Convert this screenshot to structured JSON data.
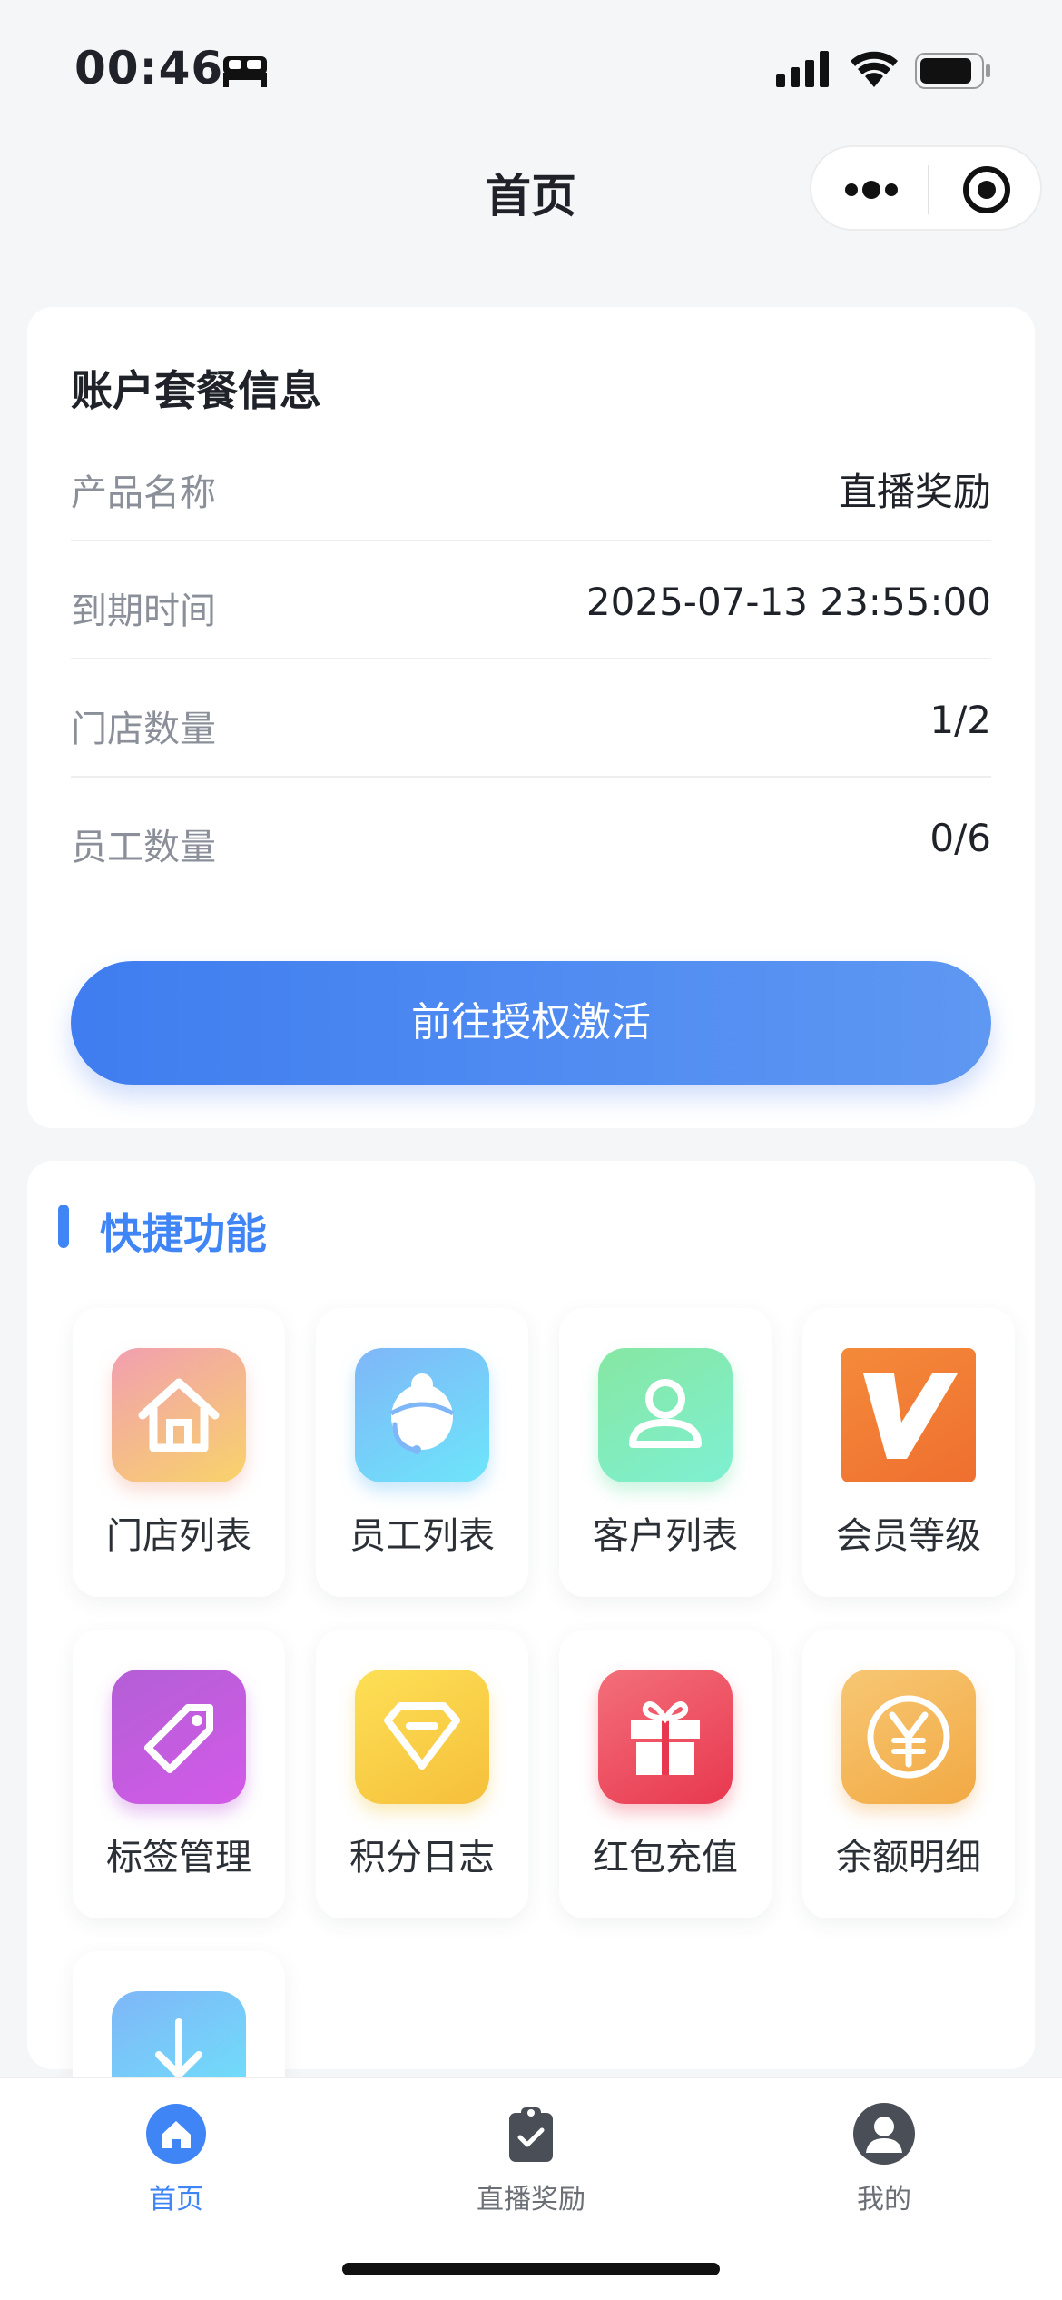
{
  "status_bar": {
    "time": "00:46"
  },
  "nav": {
    "title": "首页"
  },
  "account_card": {
    "title": "账户套餐信息",
    "rows": [
      {
        "label": "产品名称",
        "value": "直播奖励"
      },
      {
        "label": "到期时间",
        "value": "2025-07-13 23:55:00"
      },
      {
        "label": "门店数量",
        "value": "1/2"
      },
      {
        "label": "员工数量",
        "value": "0/6"
      }
    ],
    "button_label": "前往授权激活"
  },
  "quick_functions": {
    "title": "快捷功能",
    "items": [
      {
        "label": "门店列表",
        "icon": "store-icon"
      },
      {
        "label": "员工列表",
        "icon": "staff-icon"
      },
      {
        "label": "客户列表",
        "icon": "customer-icon"
      },
      {
        "label": "会员等级",
        "icon": "vip-level-icon"
      },
      {
        "label": "标签管理",
        "icon": "tag-icon"
      },
      {
        "label": "积分日志",
        "icon": "points-icon"
      },
      {
        "label": "红包充值",
        "icon": "gift-icon"
      },
      {
        "label": "余额明细",
        "icon": "yuan-icon"
      },
      {
        "label": "",
        "icon": "download-icon"
      }
    ]
  },
  "tab_bar": {
    "items": [
      {
        "label": "首页",
        "icon": "home-icon",
        "active": true
      },
      {
        "label": "直播奖励",
        "icon": "clipboard-check-icon",
        "active": false
      },
      {
        "label": "我的",
        "icon": "user-icon",
        "active": false
      }
    ]
  },
  "colors": {
    "accent": "#3f85f5",
    "button_start": "#3f7df0",
    "button_end": "#5e98f2"
  }
}
